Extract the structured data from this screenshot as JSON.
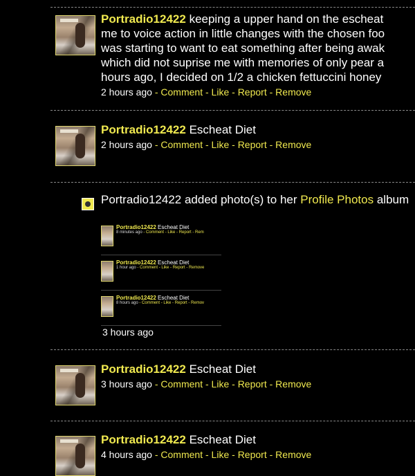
{
  "posts": [
    {
      "username": "Portradio12422",
      "text": " keeping a upper hand on the escheat",
      "lines": [
        "me to voice action in little changes with the chosen foo",
        "was starting to want to eat something after being awak",
        "which did not suprise me with memories of only pear a",
        "hours ago, I decided on 1/2 a chicken fettuccini honey"
      ],
      "time": "2 hours ago"
    },
    {
      "username": "Portradio12422",
      "text": " Escheat Diet",
      "time": "2 hours ago"
    },
    {
      "username": "Portradio12422",
      "text": " Escheat Diet",
      "time": "3 hours ago"
    },
    {
      "username": "Portradio12422",
      "text": " Escheat Diet",
      "time": "4 hours ago"
    }
  ],
  "actions": {
    "comment": "Comment",
    "like": "Like",
    "report": "Report",
    "remove": "Remove",
    "sep": " - "
  },
  "activity": {
    "text": "Portradio12422 added photo(s) to her ",
    "album_link": "Profile Photos",
    "album_suffix": " album",
    "time": "3 hours ago",
    "thumbnails": [
      {
        "username": "Portradio12422",
        "title": " Escheat Diet",
        "time": "8 minutes ago",
        "actions": " - Comment - Like - Report - Rem"
      },
      {
        "username": "Portradio12422",
        "title": " Escheat Diet",
        "time": "1 hour ago",
        "actions": " - Comment - Like - Report - Remove"
      },
      {
        "username": "Portradio12422",
        "title": " Escheat Diet",
        "time": "8 hours ago",
        "actions": " - Comment - Like - Report - Remov"
      }
    ]
  },
  "colors": {
    "accent": "#f0e94f",
    "background": "#000000",
    "text": "#ffffff"
  },
  "icons": {
    "activity": "camera-icon"
  }
}
